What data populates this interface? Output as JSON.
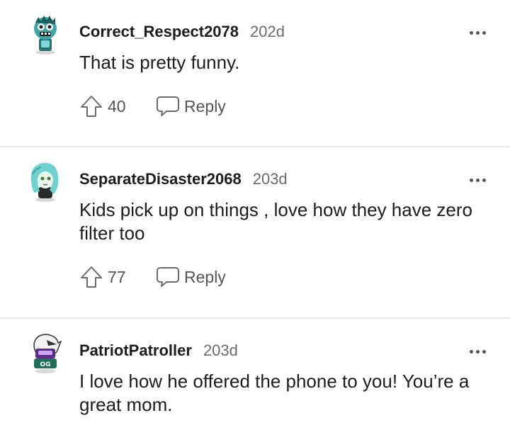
{
  "comments": [
    {
      "username": "Correct_Respect2078",
      "age": "202d",
      "text": "That is pretty funny.",
      "upvotes": "40",
      "reply_label": "Reply",
      "avatar_icon": "teal-robot-avatar"
    },
    {
      "username": "SeparateDisaster2068",
      "age": "203d",
      "text": "Kids pick up on things , love how they have zero filter too",
      "upvotes": "77",
      "reply_label": "Reply",
      "avatar_icon": "aqua-haired-avatar"
    },
    {
      "username": "PatriotPatroller",
      "age": "203d",
      "text": "I love how he offered the phone to you! You’re a great mom.",
      "upvotes": null,
      "reply_label": null,
      "avatar_icon": "eagle-helmet-avatar",
      "avatar_badge": "OG"
    }
  ],
  "colors": {
    "text": "#1c1c1c",
    "meta": "#6b6b6b",
    "action": "#555555",
    "divider": "#e5e5e5"
  },
  "icons": {
    "upvote": "upvote-arrow-icon",
    "reply": "speech-bubble-icon",
    "more": "more-options-icon"
  }
}
